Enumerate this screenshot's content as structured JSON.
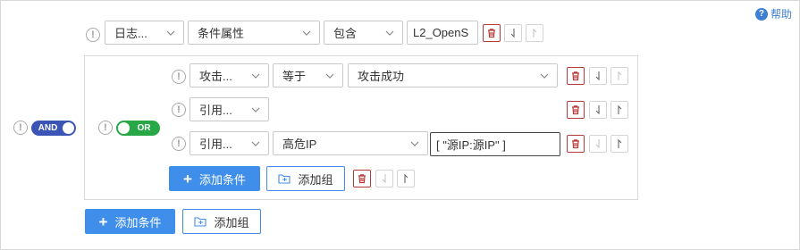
{
  "help": {
    "label": "帮助"
  },
  "root_rule": {
    "field": "日志...",
    "attribute": "条件属性",
    "operator": "包含",
    "value": "L2_OpenS"
  },
  "root_logic": {
    "label": "AND"
  },
  "group": {
    "logic": {
      "label": "OR"
    },
    "rules": [
      {
        "field": "攻击...",
        "operator": "等于",
        "value": "攻击成功"
      },
      {
        "field": "引用..."
      },
      {
        "field": "引用...",
        "attribute": "高危IP",
        "value": "[ \"源IP:源IP\" ]"
      }
    ],
    "add_condition_label": "添加条件",
    "add_group_label": "添加组"
  },
  "footer": {
    "add_condition_label": "添加条件",
    "add_group_label": "添加组"
  },
  "colors": {
    "and_toggle": "#3b55b6",
    "or_toggle": "#27a745",
    "primary": "#3f8ee9",
    "delete": "#b63a3a"
  }
}
